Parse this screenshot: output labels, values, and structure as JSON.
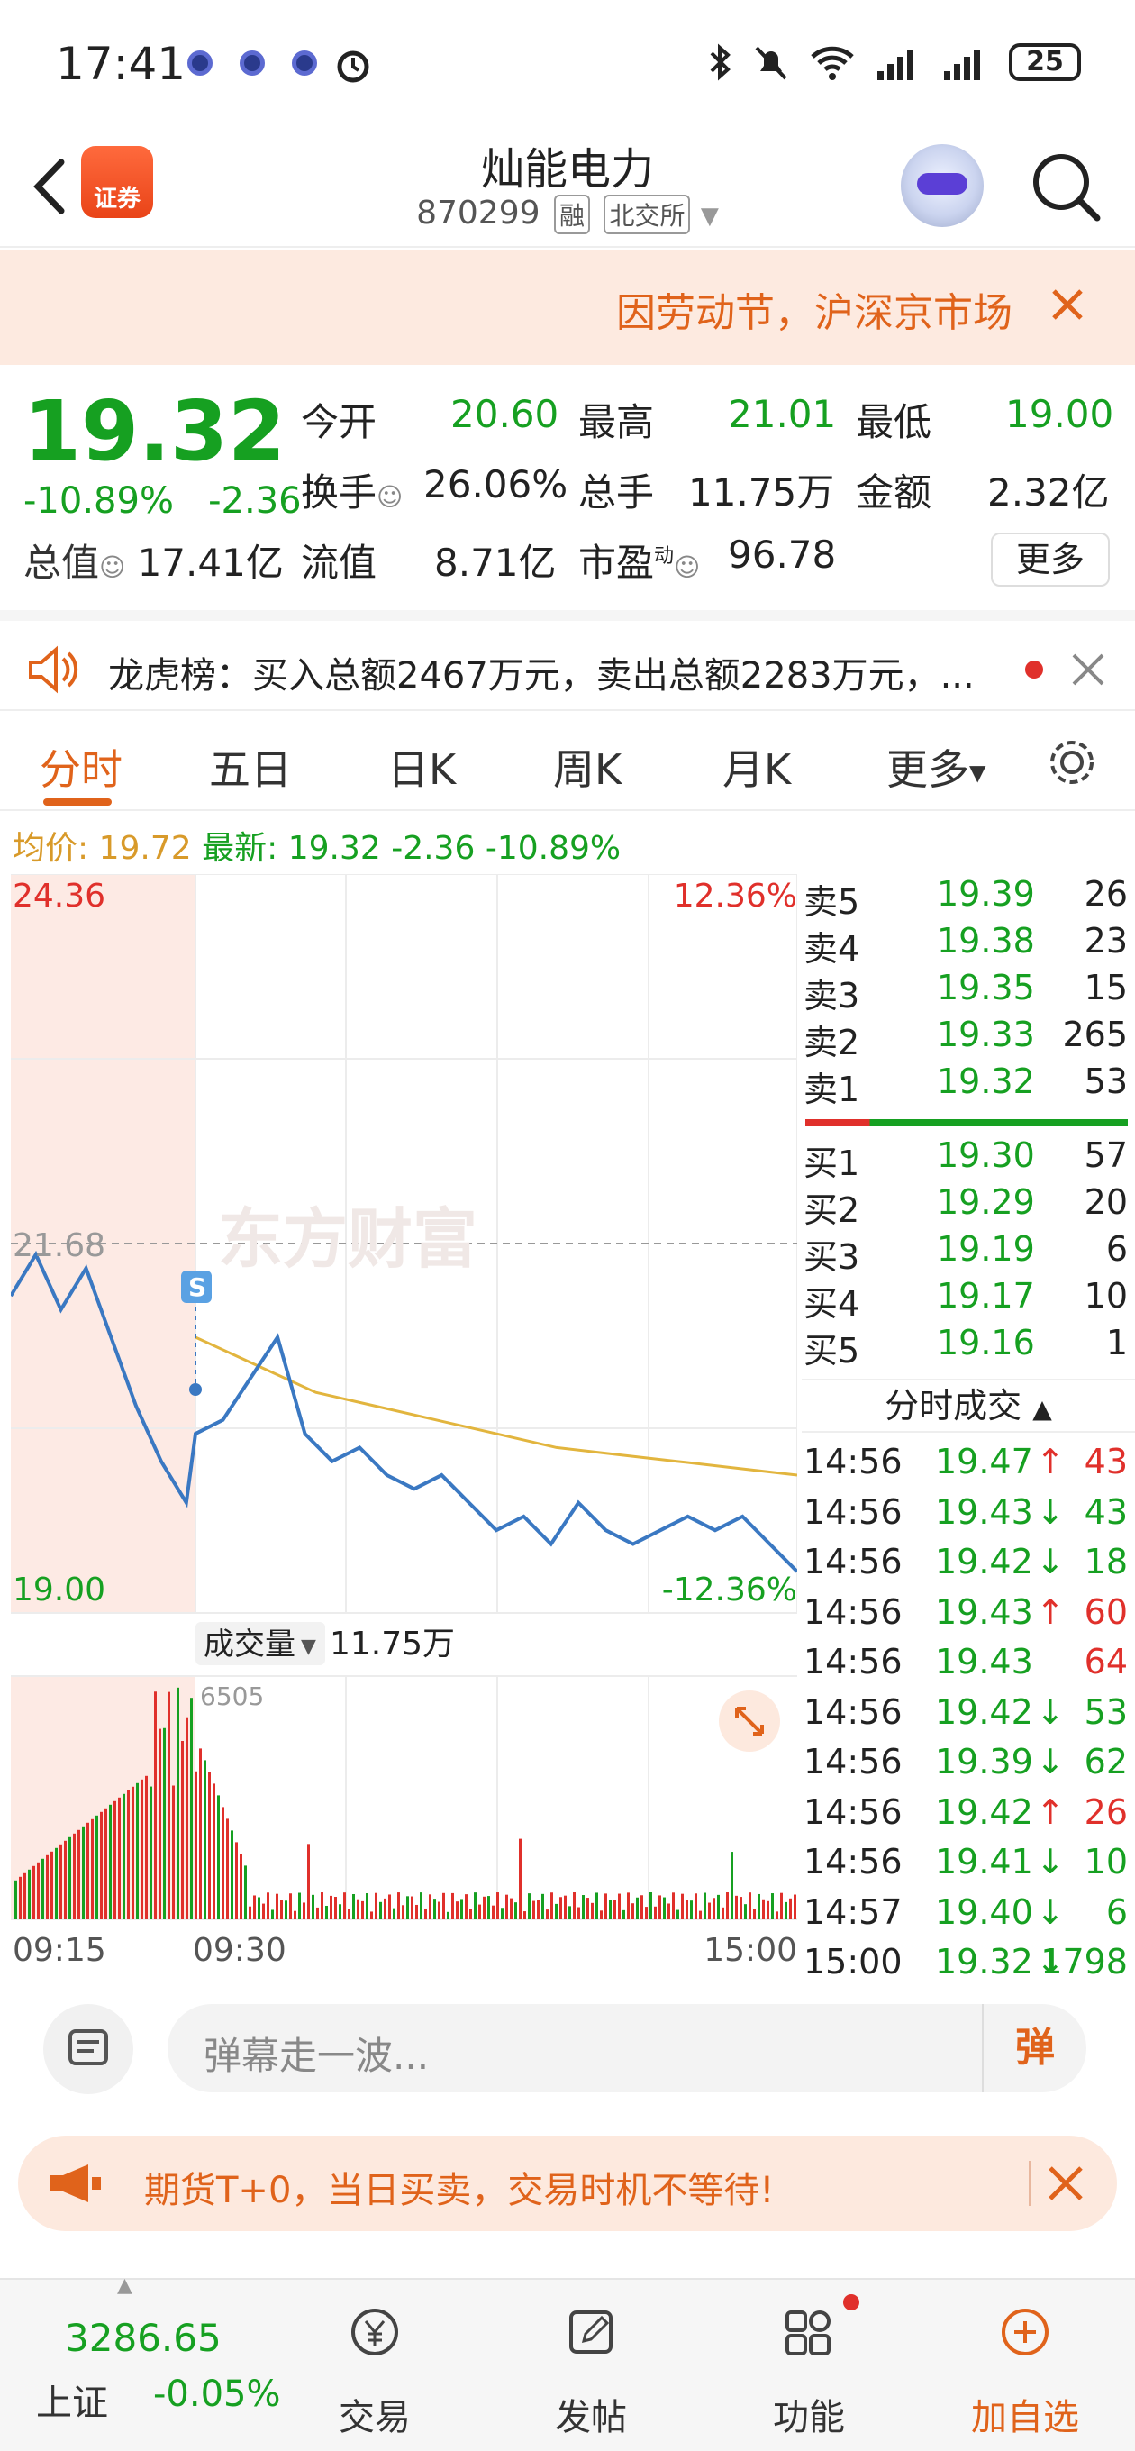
{
  "status_bar": {
    "time": "17:41",
    "battery": "25"
  },
  "header": {
    "app_logo_text": "证券",
    "stock_name": "灿能电力",
    "stock_code": "870299",
    "tag_margin": "融",
    "tag_exchange": "北交所"
  },
  "notice": {
    "text": "因劳动节，沪深京市场"
  },
  "quote": {
    "price": "19.32",
    "change_pct": "-10.89%",
    "change_amt": "-2.36",
    "open_label": "今开",
    "open": "20.60",
    "high_label": "最高",
    "high": "21.01",
    "low_label": "最低",
    "low": "19.00",
    "turnover_label": "换手",
    "turnover": "26.06%",
    "volume_label": "总手",
    "volume": "11.75万",
    "amount_label": "金额",
    "amount": "2.32亿",
    "mktcap_label": "总值",
    "mktcap": "17.41亿",
    "float_label": "流值",
    "float": "8.71亿",
    "pe_label": "市盈",
    "pe_sup": "动",
    "pe": "96.78",
    "more_label": "更多"
  },
  "lhb": {
    "text": "龙虎榜：买入总额2467万元，卖出总额2283万元，..."
  },
  "tabs": [
    "分时",
    "五日",
    "日K",
    "周K",
    "月K",
    "更多"
  ],
  "info": {
    "avg_label": "均价:",
    "avg": "19.72",
    "latest_label": "最新:",
    "latest": "19.32",
    "chg": "-2.36",
    "pct": "-10.89%"
  },
  "chart_data": {
    "type": "line",
    "title": "",
    "price_axis": {
      "top": "24.36",
      "mid": "21.68",
      "bottom": "19.00"
    },
    "pct_axis": {
      "top": "12.36%",
      "bottom": "-12.36%"
    },
    "time_labels": [
      "09:15",
      "09:30",
      "15:00"
    ],
    "watermark": "东方财富",
    "marker": "S",
    "volume_label": "成交量",
    "volume_total": "11.75万",
    "volume_max": "6505",
    "ylim": [
      19.0,
      24.36
    ],
    "series": [
      {
        "values": [
          21.3,
          21.6,
          21.2,
          21.5,
          21.0,
          20.5,
          20.1,
          19.8,
          20.3,
          20.4,
          20.7,
          21.0,
          20.3,
          20.1,
          20.2,
          20.0,
          19.9,
          20.0,
          19.8,
          19.6,
          19.7,
          19.5,
          19.8,
          19.6,
          19.5,
          19.6,
          19.7,
          19.6,
          19.7,
          19.5,
          19.3
        ]
      },
      {
        "values": [
          21.0,
          20.8,
          20.6,
          20.5,
          20.4,
          20.3,
          20.2,
          20.15,
          20.1,
          20.05,
          20.0
        ]
      }
    ]
  },
  "orderbook": {
    "asks": [
      {
        "label": "卖5",
        "price": "19.39",
        "vol": "26"
      },
      {
        "label": "卖4",
        "price": "19.38",
        "vol": "23"
      },
      {
        "label": "卖3",
        "price": "19.35",
        "vol": "15"
      },
      {
        "label": "卖2",
        "price": "19.33",
        "vol": "265"
      },
      {
        "label": "卖1",
        "price": "19.32",
        "vol": "53"
      }
    ],
    "bids": [
      {
        "label": "买1",
        "price": "19.30",
        "vol": "57"
      },
      {
        "label": "买2",
        "price": "19.29",
        "vol": "20"
      },
      {
        "label": "买3",
        "price": "19.19",
        "vol": "6"
      },
      {
        "label": "买4",
        "price": "19.17",
        "vol": "10"
      },
      {
        "label": "买5",
        "price": "19.16",
        "vol": "1"
      }
    ],
    "ticks_title": "分时成交",
    "ticks": [
      {
        "time": "14:56",
        "price": "19.47",
        "arrow": "↑",
        "vol": "43",
        "dir": "up"
      },
      {
        "time": "14:56",
        "price": "19.43",
        "arrow": "↓",
        "vol": "43",
        "dir": "down"
      },
      {
        "time": "14:56",
        "price": "19.42",
        "arrow": "↓",
        "vol": "18",
        "dir": "down"
      },
      {
        "time": "14:56",
        "price": "19.43",
        "arrow": "↑",
        "vol": "60",
        "dir": "up"
      },
      {
        "time": "14:56",
        "price": "19.43",
        "arrow": "",
        "vol": "64",
        "dir": "up"
      },
      {
        "time": "14:56",
        "price": "19.42",
        "arrow": "↓",
        "vol": "53",
        "dir": "down"
      },
      {
        "time": "14:56",
        "price": "19.39",
        "arrow": "↓",
        "vol": "62",
        "dir": "down"
      },
      {
        "time": "14:56",
        "price": "19.42",
        "arrow": "↑",
        "vol": "26",
        "dir": "up"
      },
      {
        "time": "14:56",
        "price": "19.41",
        "arrow": "↓",
        "vol": "10",
        "dir": "down"
      },
      {
        "time": "14:57",
        "price": "19.40",
        "arrow": "↓",
        "vol": "6",
        "dir": "down"
      },
      {
        "time": "15:00",
        "price": "19.32",
        "arrow": "↓",
        "vol": "1798",
        "dir": "down"
      }
    ]
  },
  "danmu": {
    "placeholder": "弹幕走一波...",
    "button": "弹"
  },
  "promo": {
    "text": "期货T+0，当日买卖，交易时机不等待!"
  },
  "bottom_nav": {
    "index_value": "3286.65",
    "index_name": "上证",
    "index_pct": "-0.05%",
    "items": [
      "交易",
      "发帖",
      "功能",
      "加自选"
    ]
  },
  "colors": {
    "up": "#e0302b",
    "down": "#16a021",
    "accent": "#e0631b",
    "price_line": "#3a78c2",
    "avg_line": "#e2b53e"
  }
}
